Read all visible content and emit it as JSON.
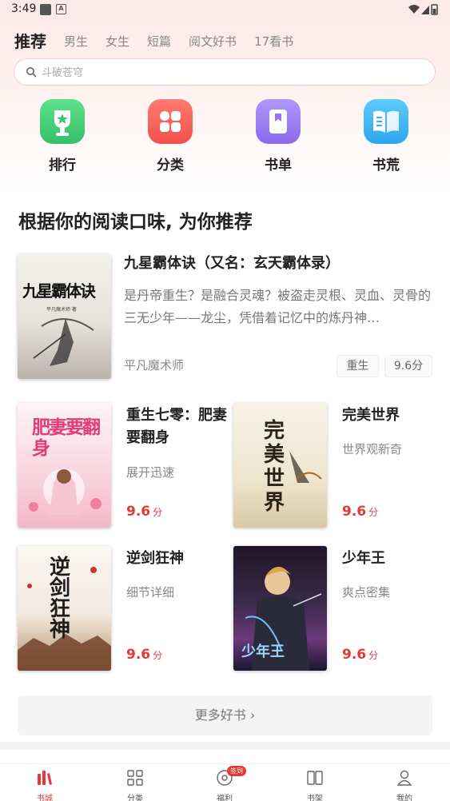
{
  "status": {
    "time": "3:49"
  },
  "tabs": [
    {
      "label": "推荐",
      "active": true
    },
    {
      "label": "男生"
    },
    {
      "label": "女生"
    },
    {
      "label": "短篇"
    },
    {
      "label": "阅文好书"
    },
    {
      "label": "17看书"
    }
  ],
  "search": {
    "placeholder": "斗破苍穹"
  },
  "quick_nav": [
    {
      "label": "排行",
      "icon": "trophy-icon",
      "color": "#4cd07a"
    },
    {
      "label": "分类",
      "icon": "grid-icon",
      "color": "#f7615c"
    },
    {
      "label": "书单",
      "icon": "book-list-icon",
      "color": "#9b7cf0"
    },
    {
      "label": "书荒",
      "icon": "open-book-icon",
      "color": "#3db4f5"
    }
  ],
  "section": {
    "title": "根据你的阅读口味, 为你推荐"
  },
  "featured": {
    "title": "九星霸体诀（又名：玄天霸体录）",
    "description": "是丹帝重生？是融合灵魂？被盗走灵根、灵血、灵骨的三无少年——龙尘，凭借着记忆中的炼丹神…",
    "author": "平凡魔术师",
    "tags": [
      "重生",
      "9.6分"
    ],
    "cover_title": "九星霸体诀",
    "cover_author": "平凡魔术师 著"
  },
  "books": [
    {
      "title": "重生七零：肥妻要翻身",
      "desc": "展开迅速",
      "score": "9.6",
      "unit": "分",
      "cover_title": "肥妻要翻身"
    },
    {
      "title": "完美世界",
      "desc": "世界观新奇",
      "score": "9.6",
      "unit": "分",
      "cover_title": "完美世界"
    },
    {
      "title": "逆剑狂神",
      "desc": "细节详细",
      "score": "9.6",
      "unit": "分",
      "cover_title": "逆剑狂神"
    },
    {
      "title": "少年王",
      "desc": "爽点密集",
      "score": "9.6",
      "unit": "分",
      "cover_title": "少年王"
    }
  ],
  "more": {
    "label": "更多好书 ›"
  },
  "bottom_nav": [
    {
      "label": "书城",
      "active": true
    },
    {
      "label": "分类"
    },
    {
      "label": "福利",
      "badge": "签到"
    },
    {
      "label": "书架"
    },
    {
      "label": "我的"
    }
  ],
  "colors": {
    "accent": "#e53935"
  }
}
